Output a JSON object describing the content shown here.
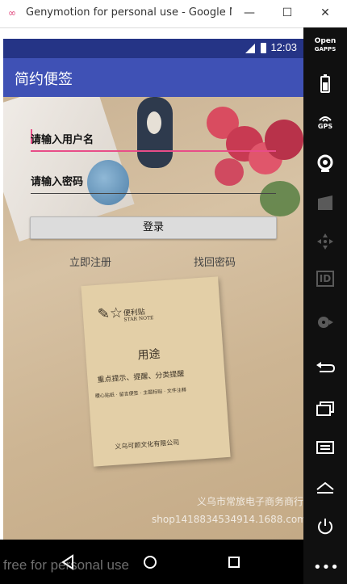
{
  "window": {
    "title": "Genymotion for personal use - Google N...",
    "minimize": "—",
    "maximize": "☐",
    "close": "✕"
  },
  "statusbar": {
    "time": "12:03"
  },
  "appbar": {
    "title": "简约便签"
  },
  "form": {
    "username_placeholder": "请输入用户名",
    "password_placeholder": "请输入密码",
    "login_label": "登录",
    "register_label": "立即注册",
    "forgot_label": "找回密码"
  },
  "card": {
    "brand": "便利贴",
    "brand_sub": "STAR NOTE",
    "title": "用途",
    "line1": "重点提示、提醒、分类提醒",
    "line2": "暖心贴纸 · 留言便签 · 主题标贴 · 文件注释",
    "company": "义乌可颜文化有限公司"
  },
  "watermark": {
    "shop": "义乌市常旅电子商务商行",
    "url": "shop1418834534914.1688.com"
  },
  "overlay_text": "free for personal use",
  "sidebar": {
    "open_gapps_1": "Open",
    "open_gapps_2": "GAPPS",
    "gps_label": "GPS",
    "id_label": "ID"
  },
  "colors": {
    "appbar": "#3f51b5",
    "statusbar": "#253486",
    "accent": "#e84d88"
  }
}
